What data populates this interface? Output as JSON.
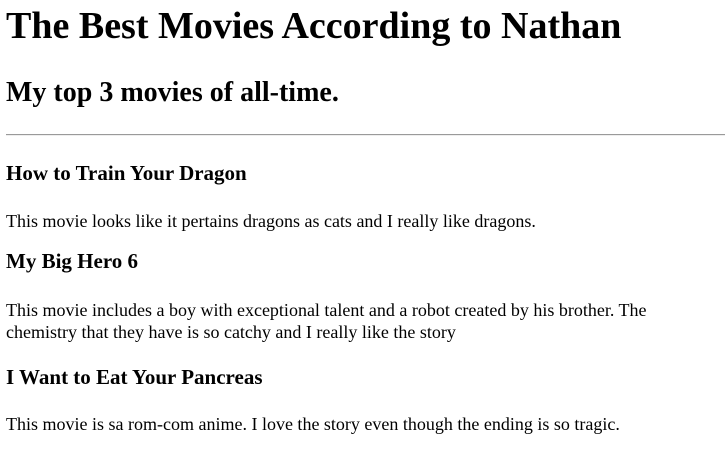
{
  "page": {
    "title": "The Best Movies According to Nathan",
    "subtitle": "My top 3 movies of all-time."
  },
  "movies": [
    {
      "title": "How to Train Your Dragon",
      "description": "This movie looks like it pertains dragons as cats and I really like dragons."
    },
    {
      "title": "My Big Hero 6",
      "description": "This movie includes a boy with exceptional talent and a robot created by his brother. The chemistry that they have is so catchy and I really like the story"
    },
    {
      "title": "I Want to Eat Your Pancreas",
      "description": "This movie is sa rom-com anime. I love the story even though the ending is so tragic."
    }
  ]
}
